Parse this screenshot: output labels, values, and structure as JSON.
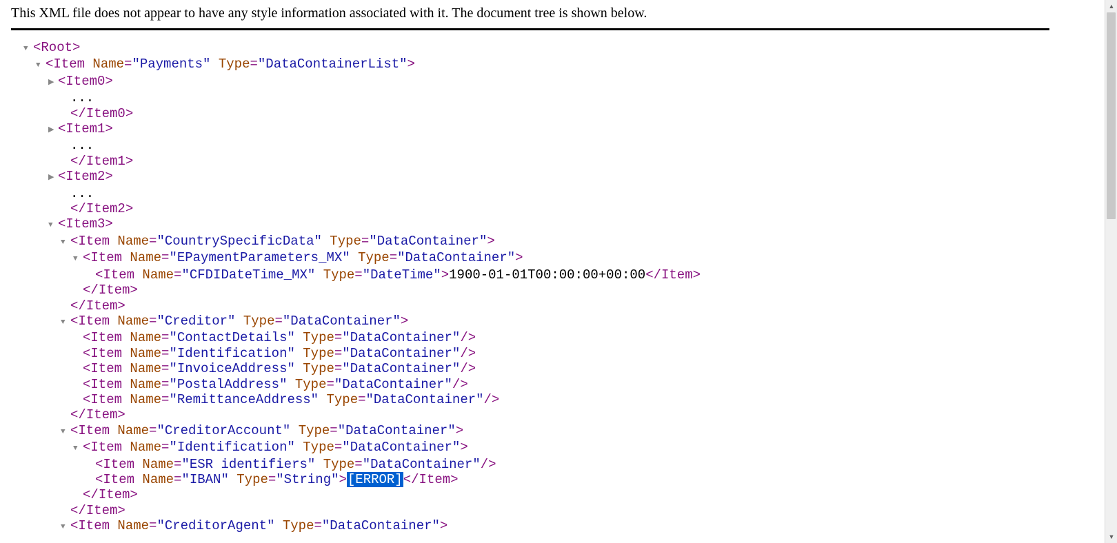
{
  "notice": "This XML file does not appear to have any style information associated with it. The document tree is shown below.",
  "tags": {
    "root": "Root",
    "item": "Item",
    "item0": "Item0",
    "item1": "Item1",
    "item2": "Item2",
    "item3": "Item3"
  },
  "attrs": {
    "name_label": "Name",
    "type_label": "Type",
    "payments": "\"Payments\"",
    "dcl": "\"DataContainerList\"",
    "dc": "\"DataContainer\"",
    "dt": "\"DateTime\"",
    "str": "\"String\"",
    "countrySpecificData": "\"CountrySpecificData\"",
    "epaymentParams": "\"EPaymentParameters_MX\"",
    "cfdi": "\"CFDIDateTime_MX\"",
    "creditor": "\"Creditor\"",
    "contactDetails": "\"ContactDetails\"",
    "identification": "\"Identification\"",
    "invoiceAddress": "\"InvoiceAddress\"",
    "postalAddress": "\"PostalAddress\"",
    "remittanceAddress": "\"RemittanceAddress\"",
    "creditorAccount": "\"CreditorAccount\"",
    "esr": "\"ESR identifiers\"",
    "iban": "\"IBAN\"",
    "creditorAgent": "\"CreditorAgent\""
  },
  "values": {
    "dots": "...",
    "datetime": "1900-01-01T00:00:00+00:00",
    "error": "[ERROR]"
  },
  "glyphs": {
    "down": "▼",
    "right": "▶",
    "sb_up": "▲",
    "sb_down": "▼"
  }
}
